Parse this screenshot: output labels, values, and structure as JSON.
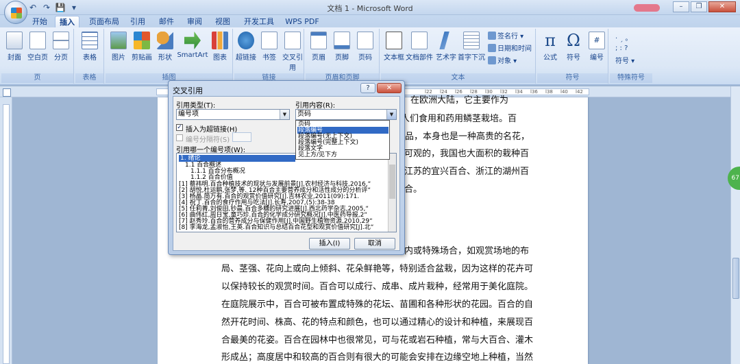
{
  "window": {
    "title": "文档 1 - Microsoft Word",
    "min": "–",
    "max": "❐",
    "close": "✕"
  },
  "qat": {
    "undo": "↶",
    "redo": "↷",
    "save": "💾",
    "more": "▾"
  },
  "tabs": [
    {
      "label": "开始"
    },
    {
      "label": "插入"
    },
    {
      "label": "页面布局"
    },
    {
      "label": "引用"
    },
    {
      "label": "邮件"
    },
    {
      "label": "审阅"
    },
    {
      "label": "视图"
    },
    {
      "label": "开发工具"
    },
    {
      "label": "WPS PDF"
    }
  ],
  "ribbon": {
    "groups": {
      "pages": "页",
      "tables": "表格",
      "illustrations": "插图",
      "links": "链接",
      "header_footer": "页眉和页脚",
      "text": "文本",
      "symbols": "符号",
      "special": "特殊符号"
    },
    "buttons": {
      "cover": "封面",
      "blank": "空白页",
      "break": "分页",
      "table": "表格",
      "picture": "图片",
      "clipart": "剪贴画",
      "shapes": "形状",
      "smartart": "SmartArt",
      "chart": "图表",
      "hyperlink": "超链接",
      "bookmark": "书签",
      "crossref": "交叉引用",
      "header": "页眉",
      "footer": "页脚",
      "pagenum": "页码",
      "textbox": "文本框",
      "quickparts": "文档部件",
      "wordart": "艺术字",
      "dropcap": "首字下沉",
      "signature": "签名行 ▾",
      "datetime": "日期和时间",
      "object": "对象 ▾",
      "formula": "公式",
      "symbol": "符号",
      "number": "编号",
      "symbol_small": "符号 ▾"
    },
    "punct": "， 。 ；\n： ？\n❟"
  },
  "ruler": {
    "ticks": [
      "l22",
      "l24",
      "l26",
      "l28",
      "l30",
      "l32",
      "l34",
      "l36",
      "l38",
      "l40",
      "l42"
    ]
  },
  "document": {
    "lines_top": [
      "植物，在欧洲大陆，它主要作为",
      "中人们食用和药用鳞茎栽培。百",
      "产品，本身也是一种高贵的名花，",
      "可观的，我国也大面积的栽种百",
      "江苏的宜兴百合、浙江的湖州百",
      "合。"
    ],
    "lines_bottom": [
      "内或特殊场合，如观赏场地的布",
      "局、茎强、花向上或向上倾斜、花朵鲜艳等，特别适合盆栽，因为这样的花卉可",
      "以保持较长的观赏时间。百合可以成行、成串、成片栽种，经常用于美化庭院。",
      "在庭院展示中，百合可被布置成特殊的花坛、苗圃和各种形状的花园。百合的自",
      "然开花时间、株高、花的特点和颜色，也可以通过精心的设计和种植，来展现百",
      "合最美的花姿。百合在园林中也很常见，可与花或岩石种植，常与大百合、灌木",
      "形成丛；高度居中和较高的百合则有很大的可能会安排在边缘空地上种植，当然"
    ],
    "badge": "67"
  },
  "dialog": {
    "title": "交叉引用",
    "help": "?",
    "close": "✕",
    "ref_type_label": "引用类型(T):",
    "ref_type_value": "编号项",
    "ref_content_label": "引用内容(R):",
    "ref_content_value": "页码",
    "insert_hyperlink": "插入为超链接(H)",
    "separator_label": "编号分隔符(S)",
    "which_label": "引用哪一个编号项(W):",
    "items": [
      "1. 绪论",
      "1.1 百合概述",
      "1.1.1 百合分布概况",
      "1.1.2 百合价值",
      "[1] 蔡祎明.百合种植技术的现状与发展前景[J].农村经济与科技,2016,“",
      "[2] 胡悦,杜运鹏,张梦,等. 12种百合主要营养成分和活性成分的分析评“",
      "[3] 杨晶.简万有.百合的观赏价值研究[J].吉林农业,2011(09):171.",
      "[4] 祝丁.百合的食疗作用与吃法[J].长寿,2007,(5):38-38",
      "[5] 任莉菁,刘俊田,钞晨.百合多糖的研究进展[J].西北药学杂志,2005,“",
      "[6] 曲伟红,周日宝,童巧珍.百合的化学成分研究概况[J].中医药导报,2“",
      "[7] 赵秀玲.百合的营养成分与保健作用[J].中国野生植物资源,2010,29“",
      "[8] 李海龙,孟淑怡,王英.百合知识与总结百合花型和观赏价值研究[J].北“"
    ],
    "insert_button": "插入(I)",
    "cancel_button": "取消",
    "dropdown_options": [
      "页码",
      "段落编号",
      "段落编号(无上下文)",
      "段落编号(完整上下文)",
      "段落文字",
      "见上方/见下方"
    ],
    "dropdown_selected_index": 1
  }
}
